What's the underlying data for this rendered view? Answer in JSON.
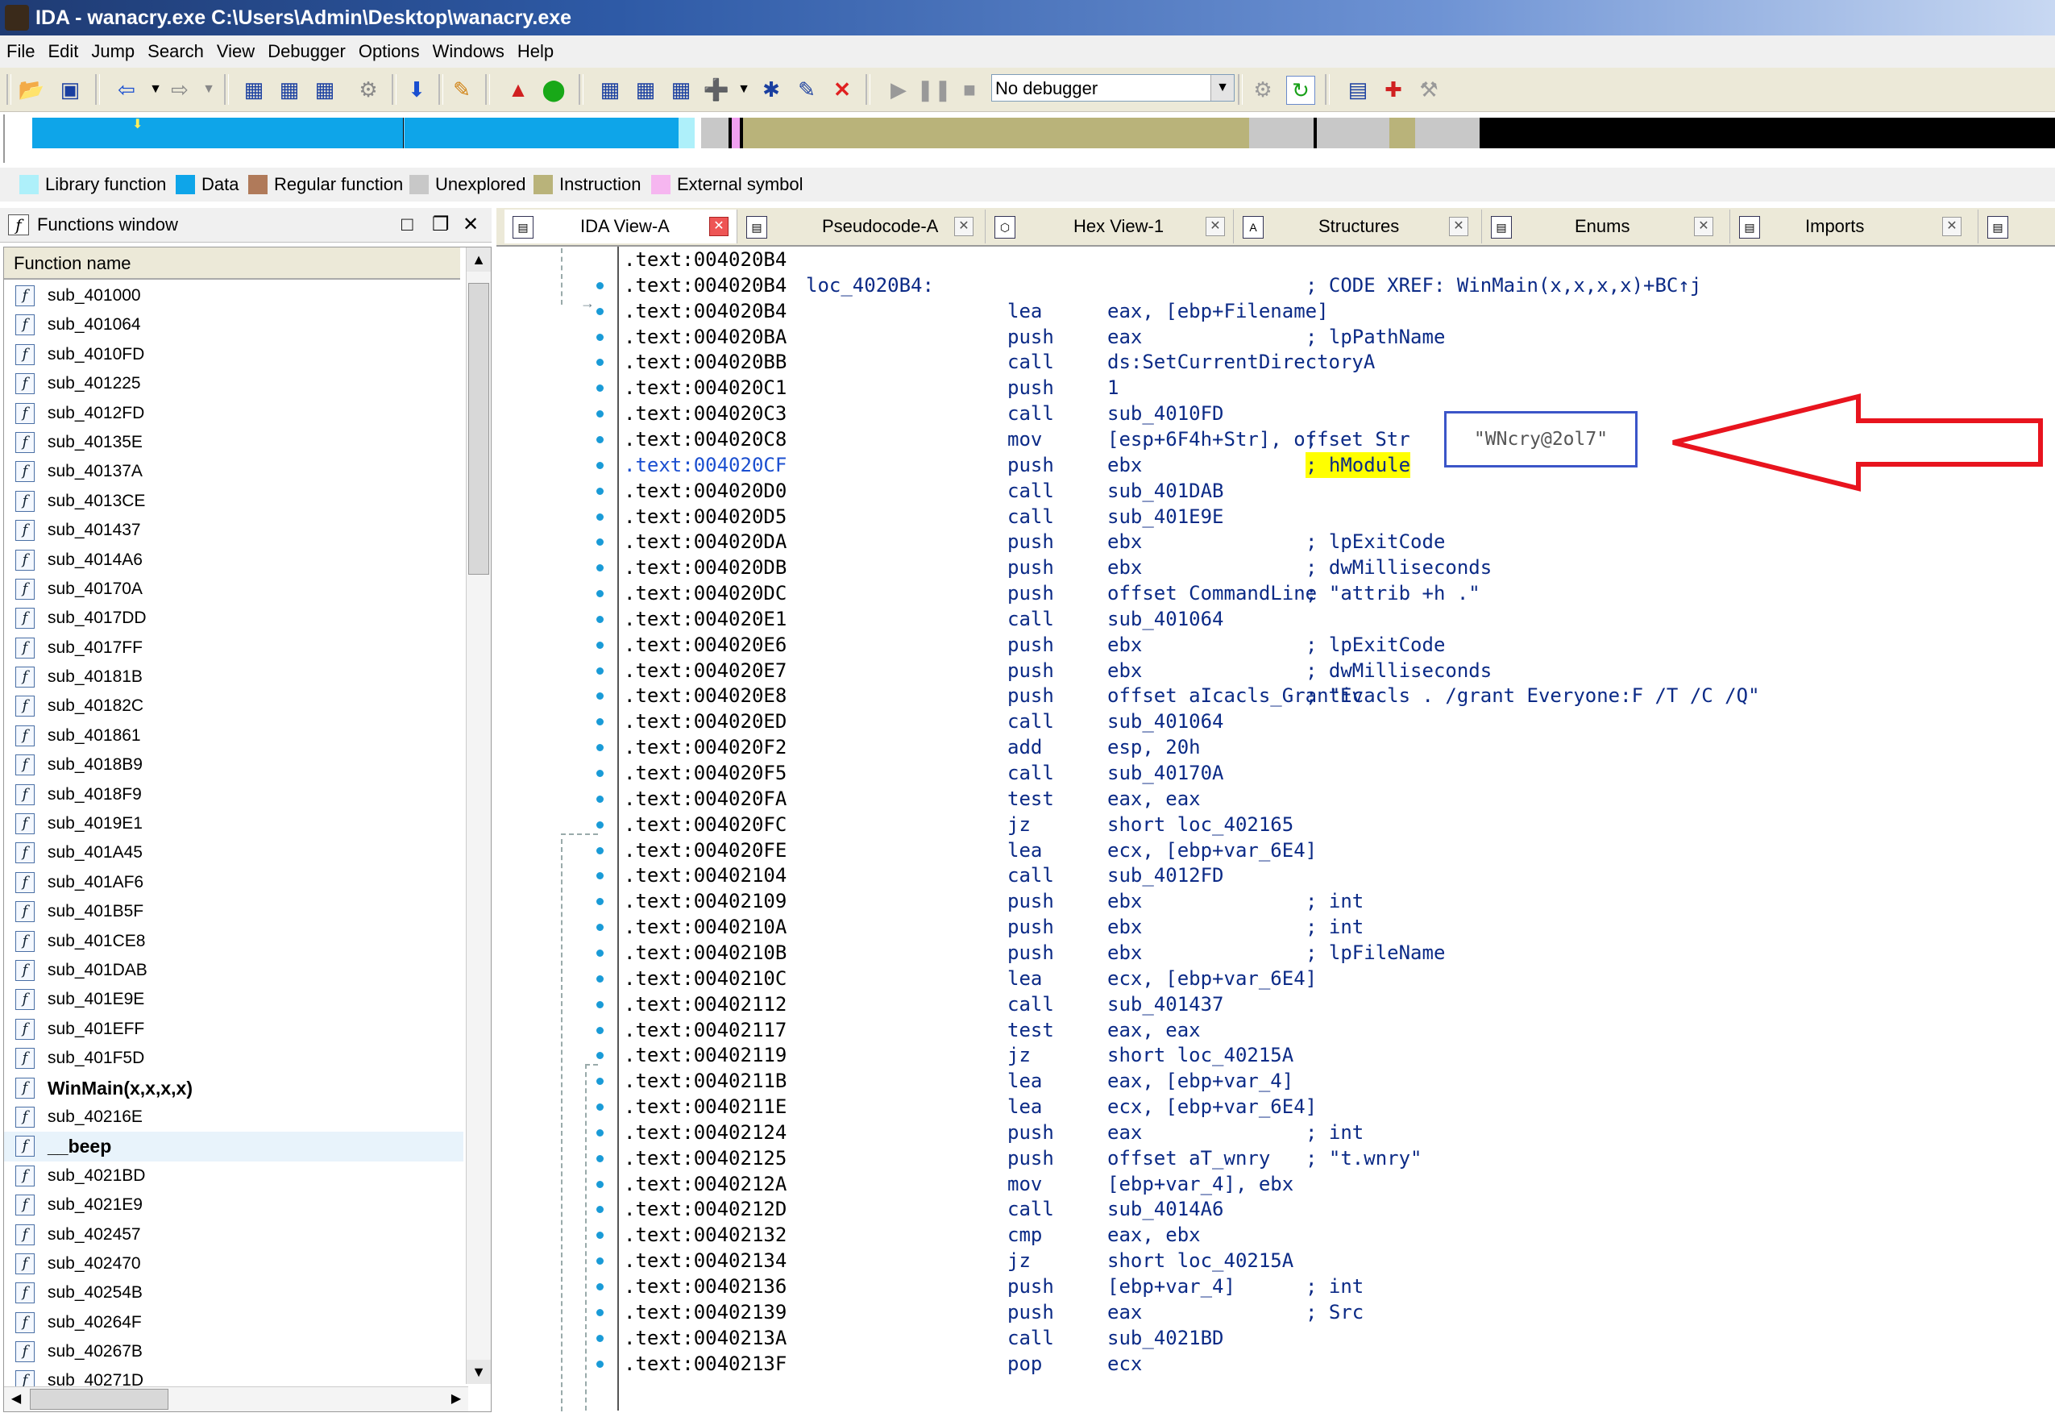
{
  "window": {
    "title": "IDA - wanacry.exe C:\\Users\\Admin\\Desktop\\wanacry.exe"
  },
  "menu": [
    "File",
    "Edit",
    "Jump",
    "Search",
    "View",
    "Debugger",
    "Options",
    "Windows",
    "Help"
  ],
  "toolbar": {
    "debugger_select": "No debugger"
  },
  "legend": [
    {
      "label": "Library function",
      "color": "#aef0fa"
    },
    {
      "label": "Data",
      "color": "#0ea5e9"
    },
    {
      "label": "Regular function",
      "color": "#b07a5a"
    },
    {
      "label": "Unexplored",
      "color": "#c8c8c8"
    },
    {
      "label": "Instruction",
      "color": "#b9b37a"
    },
    {
      "label": "External symbol",
      "color": "#f6b6f0"
    }
  ],
  "functions_window": {
    "title": "Functions window",
    "column": "Function name",
    "items": [
      "sub_401000",
      "sub_401064",
      "sub_4010FD",
      "sub_401225",
      "sub_4012FD",
      "sub_40135E",
      "sub_40137A",
      "sub_4013CE",
      "sub_401437",
      "sub_4014A6",
      "sub_40170A",
      "sub_4017DD",
      "sub_4017FF",
      "sub_40181B",
      "sub_40182C",
      "sub_401861",
      "sub_4018B9",
      "sub_4018F9",
      "sub_4019E1",
      "sub_401A45",
      "sub_401AF6",
      "sub_401B5F",
      "sub_401CE8",
      "sub_401DAB",
      "sub_401E9E",
      "sub_401EFF",
      "sub_401F5D",
      "WinMain(x,x,x,x)",
      "sub_40216E",
      "__beep",
      "sub_4021BD",
      "sub_4021E9",
      "sub_402457",
      "sub_402470",
      "sub_40254B",
      "sub_40264F",
      "sub_40267B",
      "sub_40271D"
    ],
    "bold_items": [
      "WinMain(x,x,x,x)",
      "__beep"
    ],
    "selected_item": "__beep"
  },
  "tabs": [
    {
      "label": "IDA View-A",
      "active": true
    },
    {
      "label": "Pseudocode-A",
      "active": false
    },
    {
      "label": "Hex View-1",
      "active": false
    },
    {
      "label": "Structures",
      "active": false
    },
    {
      "label": "Enums",
      "active": false
    },
    {
      "label": "Imports",
      "active": false
    }
  ],
  "disassembly": [
    {
      "addr": ".text:004020B4"
    },
    {
      "addr": ".text:004020B4",
      "label": "loc_4020B4:",
      "comment": "; CODE XREF: WinMain(x,x,x,x)+BC↑j"
    },
    {
      "addr": ".text:004020B4",
      "mn": "lea",
      "op": "eax, [ebp+Filename]"
    },
    {
      "addr": ".text:004020BA",
      "mn": "push",
      "op": "eax",
      "comment": "; lpPathName"
    },
    {
      "addr": ".text:004020BB",
      "mn": "call",
      "op": "ds:SetCurrentDirectoryA"
    },
    {
      "addr": ".text:004020C1",
      "mn": "push",
      "op": "1"
    },
    {
      "addr": ".text:004020C3",
      "mn": "call",
      "op": "sub_4010FD"
    },
    {
      "addr": ".text:004020C8",
      "mn": "mov",
      "op": "[esp+6F4h+Str], offset Str",
      "comment": ";"
    },
    {
      "addr": ".text:004020CF",
      "mn": "push",
      "op": "ebx",
      "comment": "; hModule",
      "hl": true
    },
    {
      "addr": ".text:004020D0",
      "mn": "call",
      "op": "sub_401DAB"
    },
    {
      "addr": ".text:004020D5",
      "mn": "call",
      "op": "sub_401E9E"
    },
    {
      "addr": ".text:004020DA",
      "mn": "push",
      "op": "ebx",
      "comment": "; lpExitCode"
    },
    {
      "addr": ".text:004020DB",
      "mn": "push",
      "op": "ebx",
      "comment": "; dwMilliseconds"
    },
    {
      "addr": ".text:004020DC",
      "mn": "push",
      "op": "offset CommandLine",
      "comment": "; \"attrib +h .\""
    },
    {
      "addr": ".text:004020E1",
      "mn": "call",
      "op": "sub_401064"
    },
    {
      "addr": ".text:004020E6",
      "mn": "push",
      "op": "ebx",
      "comment": "; lpExitCode"
    },
    {
      "addr": ".text:004020E7",
      "mn": "push",
      "op": "ebx",
      "comment": "; dwMilliseconds"
    },
    {
      "addr": ".text:004020E8",
      "mn": "push",
      "op": "offset aIcacls_GrantEv",
      "comment": "; \"icacls . /grant Everyone:F /T /C /Q\""
    },
    {
      "addr": ".text:004020ED",
      "mn": "call",
      "op": "sub_401064"
    },
    {
      "addr": ".text:004020F2",
      "mn": "add",
      "op": "esp, 20h"
    },
    {
      "addr": ".text:004020F5",
      "mn": "call",
      "op": "sub_40170A"
    },
    {
      "addr": ".text:004020FA",
      "mn": "test",
      "op": "eax, eax"
    },
    {
      "addr": ".text:004020FC",
      "mn": "jz",
      "op": "short loc_402165"
    },
    {
      "addr": ".text:004020FE",
      "mn": "lea",
      "op": "ecx, [ebp+var_6E4]"
    },
    {
      "addr": ".text:00402104",
      "mn": "call",
      "op": "sub_4012FD"
    },
    {
      "addr": ".text:00402109",
      "mn": "push",
      "op": "ebx",
      "comment": "; int"
    },
    {
      "addr": ".text:0040210A",
      "mn": "push",
      "op": "ebx",
      "comment": "; int"
    },
    {
      "addr": ".text:0040210B",
      "mn": "push",
      "op": "ebx",
      "comment": "; lpFileName"
    },
    {
      "addr": ".text:0040210C",
      "mn": "lea",
      "op": "ecx, [ebp+var_6E4]"
    },
    {
      "addr": ".text:00402112",
      "mn": "call",
      "op": "sub_401437"
    },
    {
      "addr": ".text:00402117",
      "mn": "test",
      "op": "eax, eax"
    },
    {
      "addr": ".text:00402119",
      "mn": "jz",
      "op": "short loc_40215A"
    },
    {
      "addr": ".text:0040211B",
      "mn": "lea",
      "op": "eax, [ebp+var_4]"
    },
    {
      "addr": ".text:0040211E",
      "mn": "lea",
      "op": "ecx, [ebp+var_6E4]"
    },
    {
      "addr": ".text:00402124",
      "mn": "push",
      "op": "eax",
      "comment": "; int"
    },
    {
      "addr": ".text:00402125",
      "mn": "push",
      "op": "offset aT_wnry",
      "comment": "; \"t.wnry\""
    },
    {
      "addr": ".text:0040212A",
      "mn": "mov",
      "op": "[ebp+var_4], ebx"
    },
    {
      "addr": ".text:0040212D",
      "mn": "call",
      "op": "sub_4014A6"
    },
    {
      "addr": ".text:00402132",
      "mn": "cmp",
      "op": "eax, ebx"
    },
    {
      "addr": ".text:00402134",
      "mn": "jz",
      "op": "short loc_40215A"
    },
    {
      "addr": ".text:00402136",
      "mn": "push",
      "op": "[ebp+var_4]",
      "comment": "; int"
    },
    {
      "addr": ".text:00402139",
      "mn": "push",
      "op": "eax",
      "comment": "; Src"
    },
    {
      "addr": ".text:0040213A",
      "mn": "call",
      "op": "sub_4021BD"
    },
    {
      "addr": ".text:0040213F",
      "mn": "pop",
      "op": "ecx"
    }
  ],
  "annotation": {
    "text": "\"WNcry@2ol7\""
  }
}
